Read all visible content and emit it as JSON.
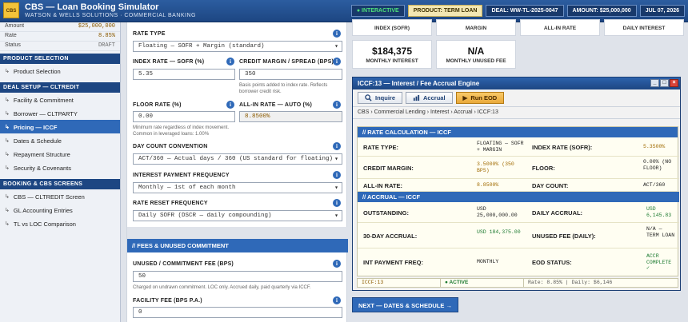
{
  "app": {
    "logo": "CBS",
    "title": "CBS — Loan Booking Simulator",
    "subtitle": "WATSON & WELLS SOLUTIONS · COMMERCIAL BANKING"
  },
  "header_badges": {
    "interactive": "● INTERACTIVE",
    "product": "PRODUCT: TERM LOAN",
    "deal": "DEAL: WW-TL-2025-0047",
    "amount": "AMOUNT: $25,000,000",
    "date": "JUL 07, 2026"
  },
  "sidebar": {
    "summary": [
      {
        "label": "Amount",
        "value": "$25,000,000"
      },
      {
        "label": "Rate",
        "value": "8.85%"
      },
      {
        "label": "Status",
        "value": "DRAFT"
      }
    ],
    "sections": [
      {
        "title": "PRODUCT SELECTION",
        "items": [
          {
            "label": "Product Selection"
          }
        ]
      },
      {
        "title": "DEAL SETUP — CLTREDIT",
        "items": [
          {
            "label": "Facility & Commitment"
          },
          {
            "label": "Borrower — CLTPARTY"
          },
          {
            "label": "Pricing — ICCF",
            "active": true
          },
          {
            "label": "Dates & Schedule"
          },
          {
            "label": "Repayment Structure"
          },
          {
            "label": "Security & Covenants"
          }
        ]
      },
      {
        "title": "BOOKING & CBS SCREENS",
        "items": [
          {
            "label": "CBS — CLTREDIT Screen"
          },
          {
            "label": "GL Accounting Entries"
          },
          {
            "label": "TL vs LOC Comparison"
          }
        ]
      }
    ]
  },
  "form": {
    "rate_type": {
      "label": "RATE TYPE",
      "value": "Floating — SOFR + Margin (standard)"
    },
    "index_rate": {
      "label": "INDEX RATE — SOFR (%)",
      "value": "5.35"
    },
    "credit_margin": {
      "label": "CREDIT MARGIN / SPREAD (BPS)",
      "value": "350",
      "hint": "Basis points added to index rate. Reflects borrower credit risk."
    },
    "floor_rate": {
      "label": "FLOOR RATE (%)",
      "value": "0.00",
      "hint": "Minimum rate regardless of index movement. Common in leveraged loans: 1.00%"
    },
    "all_in_rate": {
      "label": "ALL-IN RATE — AUTO (%)",
      "value": "8.8500%"
    },
    "day_count": {
      "label": "DAY COUNT CONVENTION",
      "value": "ACT/360 — Actual days / 360 (US standard for floating)"
    },
    "interest_freq": {
      "label": "INTEREST PAYMENT FREQUENCY",
      "value": "Monthly — 1st of each month"
    },
    "rate_reset": {
      "label": "RATE RESET FREQUENCY",
      "value": "Daily SOFR (DSCR — daily compounding)"
    },
    "fees_panel_title": "// FEES & UNUSED COMMITMENT",
    "unused_fee": {
      "label": "UNUSED / COMMITMENT FEE (BPS)",
      "value": "50",
      "hint": "Charged on undrawn commitment. LOC only. Accrued daily, paid quarterly via ICCF."
    },
    "facility_fee": {
      "label": "FACILITY FEE (BPS P.A.)",
      "value": "0"
    },
    "info_glyph": "i"
  },
  "tiles": {
    "index_sofr": "INDEX (SOFR)",
    "margin": "MARGIN",
    "all_in_rate": "ALL-IN RATE",
    "daily_interest": "DAILY INTEREST",
    "monthly_interest_value": "$184,375",
    "monthly_interest_label": "MONTHLY INTEREST",
    "unused_fee_value": "N/A",
    "unused_fee_label": "MONTHLY UNUSED FEE"
  },
  "window": {
    "title": "ICCF:13 — Interest / Fee Accrual Engine",
    "controls": {
      "min": "_",
      "max": "□",
      "close": "×"
    },
    "toolbar": {
      "inquire": "Inquire",
      "accrual": "Accrual",
      "run_eod": "Run EOD"
    },
    "breadcrumb": "CBS › Commercial Lending › Interest › Accrual › ICCF:13",
    "rate_section_title": "// RATE CALCULATION — ICCF",
    "accrual_section_title": "// ACCRUAL — ICCF",
    "rate_rows": {
      "rate_type_label": "RATE TYPE:",
      "rate_type_value": "FLOATING — SOFR + MARGIN",
      "index_rate_label": "INDEX RATE (SOFR):",
      "index_rate_value": "5.3500%",
      "credit_margin_label": "CREDIT MARGIN:",
      "credit_margin_value": "3.5000% (350 BPS)",
      "floor_label": "FLOOR:",
      "floor_value": "0.00% (NO FLOOR)",
      "all_in_label": "ALL-IN RATE:",
      "all_in_value": "8.8500%",
      "day_count_label": "DAY COUNT:",
      "day_count_value": "ACT/360"
    },
    "accrual_rows": {
      "outstanding_label": "OUTSTANDING:",
      "outstanding_value": "USD 25,000,000.00",
      "daily_accrual_label": "DAILY ACCRUAL:",
      "daily_accrual_value": "USD 6,145.83",
      "thirty_day_label": "30-DAY ACCRUAL:",
      "thirty_day_value": "USD 184,375.00",
      "unused_fee_label": "UNUSED FEE (DAILY):",
      "unused_fee_value": "N/A — TERM LOAN",
      "int_freq_label": "INT PAYMENT FREQ:",
      "int_freq_value": "MONTHLY",
      "eod_label": "EOD STATUS:",
      "eod_value": "ACCR COMPLETE ✓"
    },
    "statusbar": {
      "screen": "ICCF:13",
      "active": "● ACTIVE",
      "info": "Rate: 8.85% | Daily: $6,146"
    }
  },
  "next_button": "NEXT — DATES & SCHEDULE →",
  "colors": {
    "header": "#1d4682",
    "accent": "#2f69b8",
    "gold": "#f3c33a",
    "green": "#1c7a30"
  }
}
